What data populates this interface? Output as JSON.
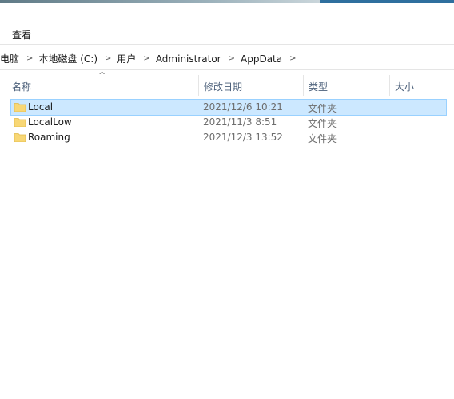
{
  "menu": {
    "view_label": "查看"
  },
  "breadcrumb": {
    "items": [
      "电脑",
      "本地磁盘 (C:)",
      "用户",
      "Administrator",
      "AppData"
    ]
  },
  "columns": {
    "name": "名称",
    "modified": "修改日期",
    "type": "类型",
    "size": "大小",
    "sort_indicator": "^"
  },
  "files": [
    {
      "name": "Local",
      "modified": "2021/12/6 10:21",
      "type": "文件夹",
      "selected": true
    },
    {
      "name": "LocalLow",
      "modified": "2021/11/3 8:51",
      "type": "文件夹",
      "selected": false
    },
    {
      "name": "Roaming",
      "modified": "2021/12/3 13:52",
      "type": "文件夹",
      "selected": false
    }
  ],
  "colors": {
    "selection_bg": "#cce8ff",
    "selection_border": "#99d1ff",
    "folder_yellow": "#f8d775",
    "header_text": "#4c607a"
  },
  "icons": {
    "folder": "folder-icon"
  }
}
